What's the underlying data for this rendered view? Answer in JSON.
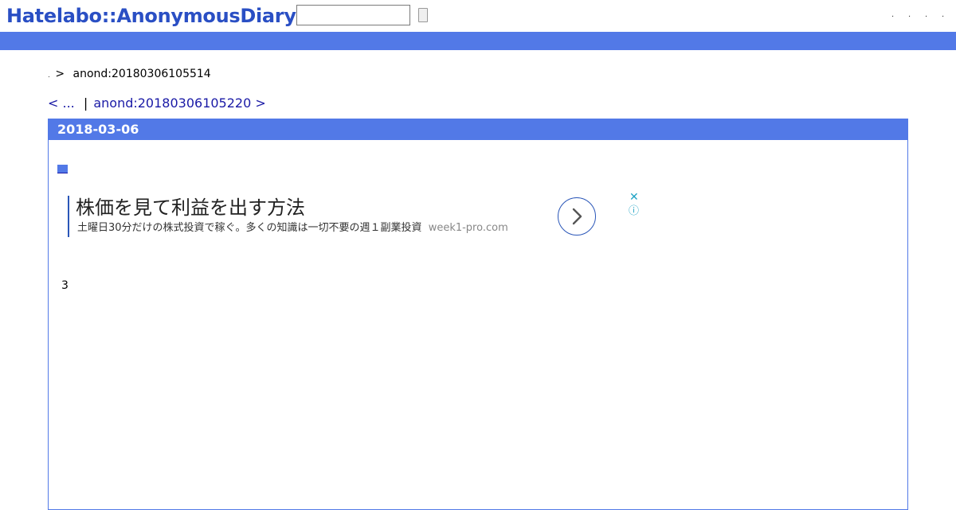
{
  "header": {
    "logo": "Hatelabo::AnonymousDiary",
    "search": {
      "value": "",
      "placeholder": ""
    },
    "search_button_label": "",
    "top_links": [
      ".",
      ".",
      ".",
      "."
    ]
  },
  "breadcrumb": {
    "home": ".",
    "separator": ">",
    "current": "anond:20180306105514"
  },
  "pager": {
    "prev": "< ...",
    "divider": "|",
    "next": "anond:20180306105220 >"
  },
  "day": {
    "date": "2018-03-06",
    "section_mark": "■",
    "body_text": "3"
  },
  "ad": {
    "title": "株価を見て利益を出す方法",
    "description": "土曜日30分だけの株式投資で稼ぐ。多くの知識は一切不要の週１副業投資",
    "domain": "week1-pro.com",
    "close": "✕",
    "info": "ⓘ"
  },
  "colors": {
    "brand_blue": "#5279e7",
    "logo_blue": "#2a4fc4",
    "link": "#1a1aa6",
    "ad_accent": "#2a56b8",
    "ad_icon": "#1fa3c4"
  }
}
